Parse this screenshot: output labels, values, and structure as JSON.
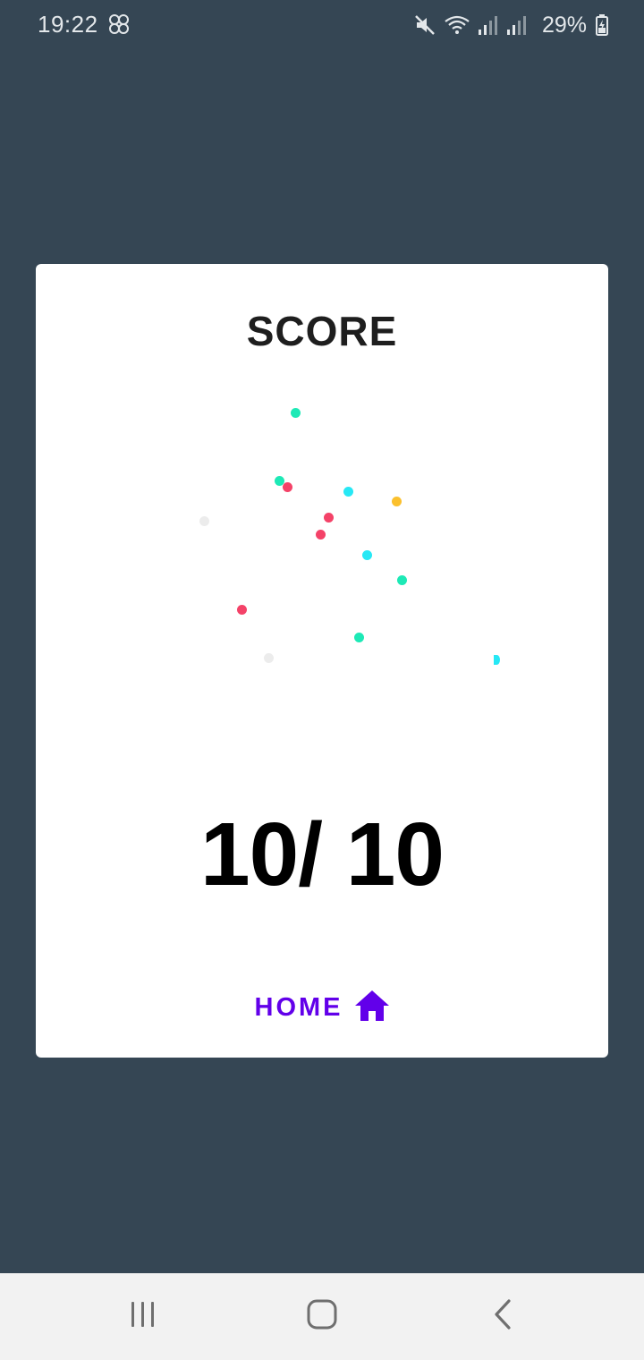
{
  "status_bar": {
    "time": "19:22",
    "left_icon": "app-notification-icon",
    "icons": [
      "mute-icon",
      "wifi-icon",
      "signal-icon",
      "signal-icon"
    ],
    "battery_percent": "29%",
    "battery_icon": "battery-charging-icon"
  },
  "card": {
    "title": "SCORE",
    "score": "10/ 10",
    "home_label": "HOME",
    "home_icon": "home-icon",
    "accent_color": "#6200ea",
    "confetti_colors": [
      "#1de9b6",
      "#f44268",
      "#26e8f5",
      "#fbc02d",
      "#ececec"
    ]
  },
  "nav_bar": {
    "buttons": [
      "recent-apps",
      "home",
      "back"
    ]
  },
  "colors": {
    "background": "#354654",
    "card": "#ffffff",
    "nav_bar": "#f2f2f2"
  }
}
